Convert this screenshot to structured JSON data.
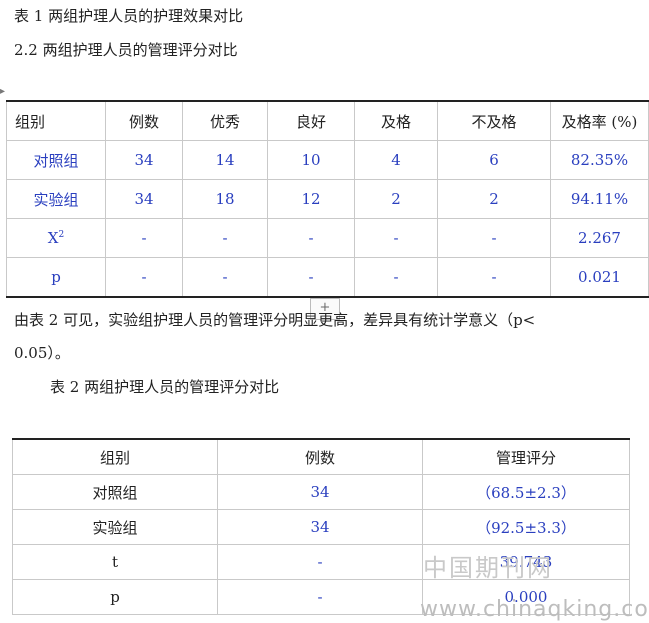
{
  "caption1": "表 1  两组护理人员的护理效果对比",
  "section_heading": "2.2 两组护理人员的管理评分对比",
  "table1": {
    "headers": [
      "组别",
      "例数",
      "优秀",
      "良好",
      "及格",
      "不及格",
      "及格率 (%)"
    ],
    "rows": [
      [
        "对照组",
        "34",
        "14",
        "10",
        "4",
        "6",
        "82.35%"
      ],
      [
        "实验组",
        "34",
        "18",
        "12",
        "2",
        "2",
        "94.11%"
      ],
      [
        "X",
        "-",
        "-",
        "-",
        "-",
        "-",
        "2.267"
      ],
      [
        "p",
        "-",
        "-",
        "-",
        "-",
        "-",
        "0.021"
      ]
    ],
    "chi_superscript": "2"
  },
  "paragraph_line1": "由表 2 可见，实验组护理人员的管理评分明显更高，差异具有统计学意义（p<",
  "paragraph_line2": "0.05）。",
  "caption2": "表 2  两组护理人员的管理评分对比",
  "table2": {
    "headers": [
      "组别",
      "例数",
      "管理评分"
    ],
    "rows": [
      [
        "对照组",
        "34",
        "（68.5±2.3）"
      ],
      [
        "实验组",
        "34",
        "（92.5±3.3）"
      ],
      [
        "t",
        "-",
        "39.743"
      ],
      [
        "p",
        "-",
        "0.000"
      ]
    ]
  },
  "table_handle": "+",
  "watermark_cn": "中国期刊网",
  "watermark_url": "www.chinaqking.com"
}
